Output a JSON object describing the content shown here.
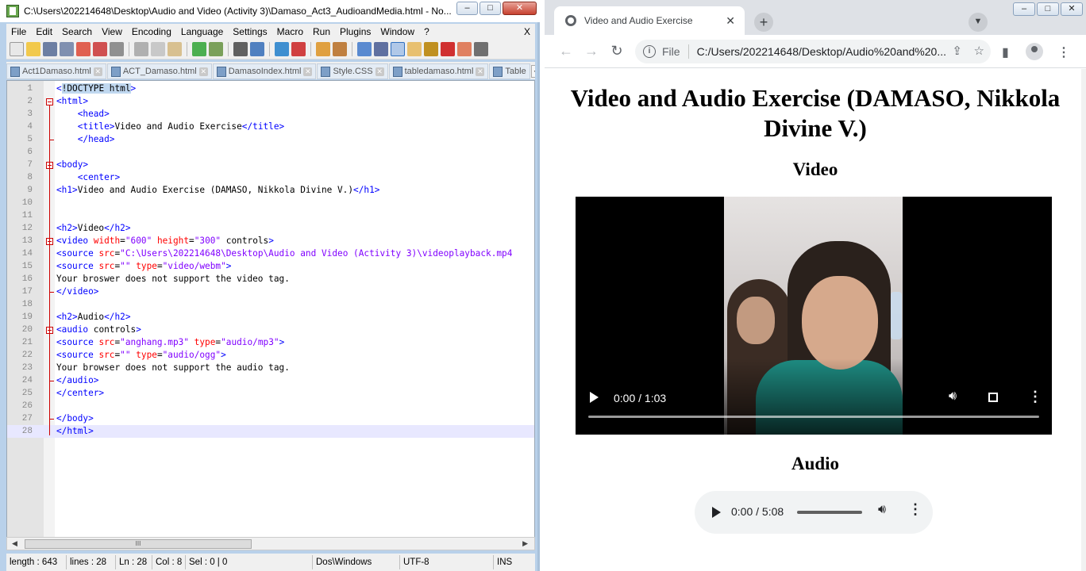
{
  "npp": {
    "title": "C:\\Users\\202214648\\Desktop\\Audio and Video (Activity 3)\\Damaso_Act3_AudioandMedia.html - No...",
    "menu": [
      "File",
      "Edit",
      "Search",
      "View",
      "Encoding",
      "Language",
      "Settings",
      "Macro",
      "Run",
      "Plugins",
      "Window",
      "?"
    ],
    "menu_close": "X",
    "tabs": [
      "Act1Damaso.html",
      "ACT_Damaso.html",
      "DamasoIndex.html",
      "Style.CSS",
      "tabledamaso.html",
      "Table"
    ],
    "line_numbers": [
      "1",
      "2",
      "3",
      "4",
      "5",
      "6",
      "7",
      "8",
      "9",
      "10",
      "11",
      "12",
      "13",
      "14",
      "15",
      "16",
      "17",
      "18",
      "19",
      "20",
      "21",
      "22",
      "23",
      "24",
      "25",
      "26",
      "27",
      "28"
    ],
    "status": {
      "length": "length : 643",
      "lines": "lines : 28",
      "ln": "Ln : 28",
      "col": "Col : 8",
      "sel": "Sel : 0 | 0",
      "eol": "Dos\\Windows",
      "encoding": "UTF-8",
      "mode": "INS"
    },
    "hscroll_thumb": "III"
  },
  "chrome": {
    "tab_title": "Video and Audio Exercise",
    "file_label": "File",
    "url": "C:/Users/202214648/Desktop/Audio%20and%20...",
    "page": {
      "h1": "Video and Audio Exercise (DAMASO, Nikkola Divine V.)",
      "h2_video": "Video",
      "video_time": "0:00 / 1:03",
      "h2_audio": "Audio",
      "audio_time": "0:00 / 5:08"
    }
  }
}
